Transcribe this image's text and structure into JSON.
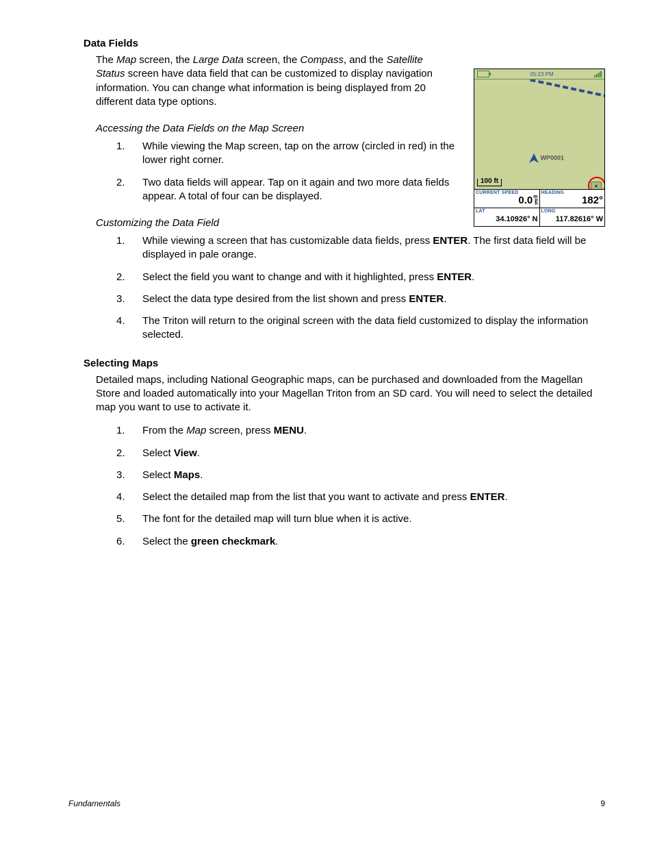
{
  "sections": {
    "dataFields": {
      "heading": "Data Fields",
      "intro_pre": "The ",
      "intro_map": "Map",
      "intro_mid1": " screen, the ",
      "intro_largeData": "Large Data",
      "intro_mid2": " screen, the ",
      "intro_compass": "Compass",
      "intro_mid3": ", and the ",
      "intro_satStatus": "Satellite Status",
      "intro_post": " screen have data field that can be customized to display navigation information.  You can change what information is being displayed from 20 different data type options.",
      "accessing": {
        "heading": "Accessing the Data Fields on the Map Screen",
        "items": [
          "While viewing the Map screen, tap on the arrow (circled in red) in the lower right corner.",
          "Two data fields will appear.  Tap on it again and two more data fields appear.  A total of four can be displayed."
        ]
      },
      "customizing": {
        "heading": "Customizing the Data Field",
        "item1_pre": "While viewing a screen that has customizable data fields, press ",
        "item1_enter": "ENTER",
        "item1_post": ".  The first data field will be displayed in pale orange.",
        "item2_pre": "Select the field you want to change and with it highlighted, press ",
        "item2_enter": "ENTER",
        "item2_post": ".",
        "item3_pre": "Select the data type desired from the list shown and press ",
        "item3_enter": "ENTER",
        "item3_post": ".",
        "item4": "The Triton will return to the original screen with the data field customized to display the information selected."
      }
    },
    "selectingMaps": {
      "heading": "Selecting Maps",
      "intro": "Detailed maps, including National Geographic maps, can be purchased and downloaded from the Magellan Store and loaded automatically into your Magellan Triton from an SD card.  You will need to select the detailed map you want to use to activate it.",
      "item1_pre": "From the ",
      "item1_map": "Map",
      "item1_mid": " screen, press ",
      "item1_menu": "MENU",
      "item1_post": ".",
      "item2_pre": "Select ",
      "item2_view": "View",
      "item2_post": ".",
      "item3_pre": "Select ",
      "item3_maps": "Maps",
      "item3_post": ".",
      "item4_pre": "Select the detailed map from the list that you want to activate and press ",
      "item4_enter": "ENTER",
      "item4_post": ".",
      "item5": "The font for the detailed map will turn blue when it is active.",
      "item6_pre": "Select the ",
      "item6_green": "green checkmark",
      "item6_post": "."
    }
  },
  "device": {
    "time": "05:23 PM",
    "scale": "100 ft",
    "waypoint": "WP0001",
    "cells": {
      "speed_label": "CURRENT SPEED",
      "speed_value": "0.0",
      "speed_unit": "m\np\nh",
      "heading_label": "HEADING",
      "heading_value": "182°",
      "lat_label": "LAT",
      "lat_value": "34.10926° N",
      "long_label": "LONG",
      "long_value": "117.82616° W"
    }
  },
  "footer": {
    "chapter": "Fundamentals",
    "page": "9"
  }
}
